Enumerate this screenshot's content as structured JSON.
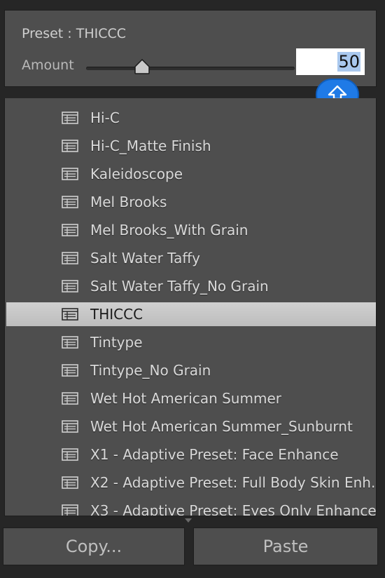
{
  "preset": {
    "text": "Preset : THICCC"
  },
  "amount": {
    "label": "Amount",
    "value": "50",
    "slider_fraction": 0.28
  },
  "list": {
    "items": [
      {
        "label": "Hi-C",
        "selected": false
      },
      {
        "label": "Hi-C_Matte Finish",
        "selected": false
      },
      {
        "label": "Kaleidoscope",
        "selected": false
      },
      {
        "label": "Mel Brooks",
        "selected": false
      },
      {
        "label": "Mel Brooks_With Grain",
        "selected": false
      },
      {
        "label": "Salt Water Taffy",
        "selected": false
      },
      {
        "label": "Salt Water Taffy_No Grain",
        "selected": false
      },
      {
        "label": "THICCC",
        "selected": true
      },
      {
        "label": "Tintype",
        "selected": false
      },
      {
        "label": "Tintype_No Grain",
        "selected": false
      },
      {
        "label": "Wet Hot American Summer",
        "selected": false
      },
      {
        "label": "Wet Hot American Summer_Sunburnt",
        "selected": false
      },
      {
        "label": "X1 - Adaptive Preset: Face Enhance",
        "selected": false
      },
      {
        "label": "X2 - Adaptive Preset: Full Body Skin Enh...",
        "selected": false
      },
      {
        "label": "X3 - Adaptive Preset: Eyes Only Enhance",
        "selected": false
      }
    ]
  },
  "buttons": {
    "copy": "Copy...",
    "paste": "Paste"
  },
  "colors": {
    "accent": "#1f7ae6",
    "panel": "#4e4e4e",
    "selected_row": "#c8c8c8"
  },
  "icons": {
    "preset": "preset-list-icon",
    "up": "upload-arrow-icon"
  }
}
